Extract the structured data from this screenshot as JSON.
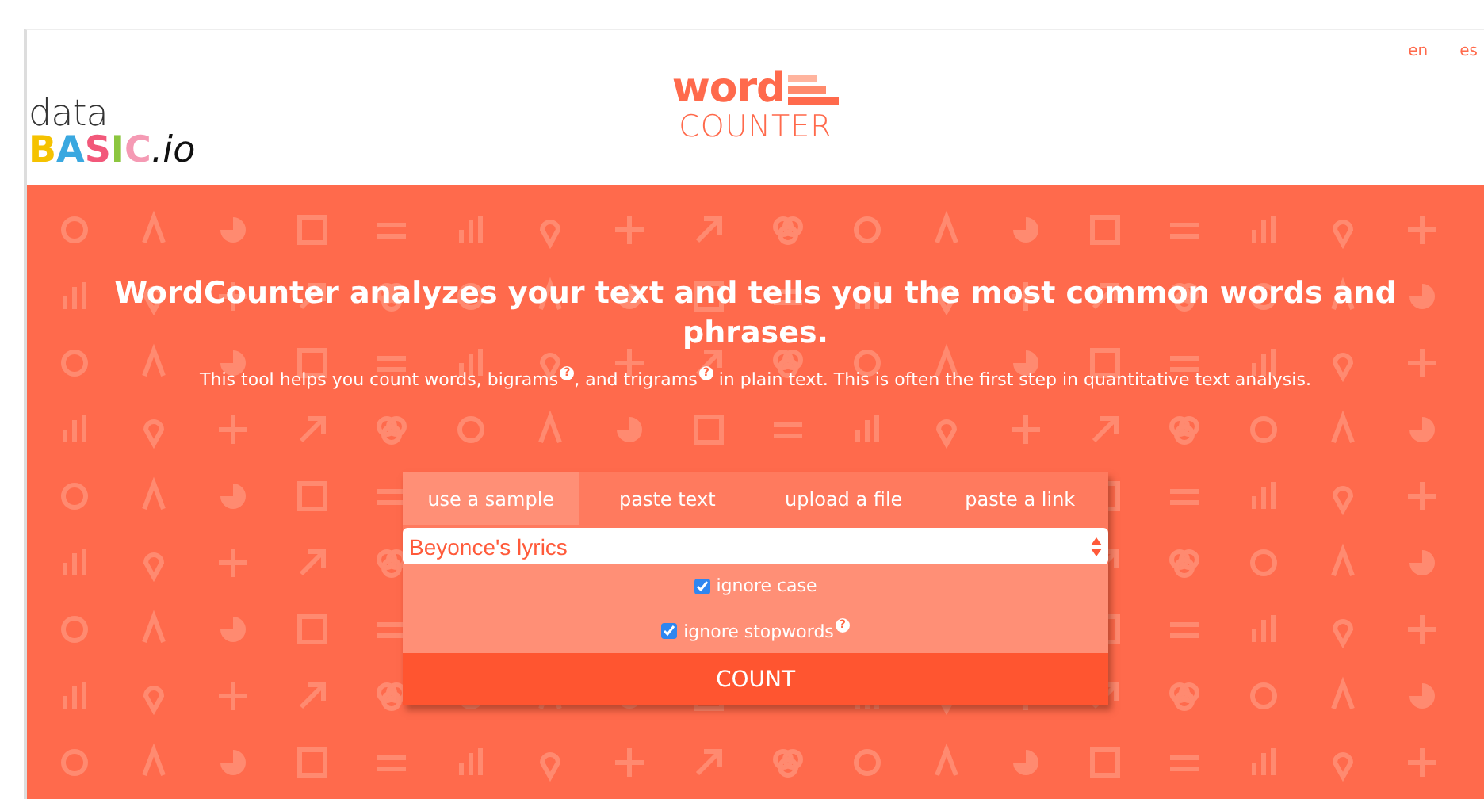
{
  "header": {
    "logo": {
      "top": "data",
      "letters": [
        {
          "text": "B",
          "color": "#f5c200"
        },
        {
          "text": "A",
          "color": "#3aa8e0"
        },
        {
          "text": "S",
          "color": "#f2587a"
        },
        {
          "text": "I",
          "color": "#8cc63f"
        },
        {
          "text": "C",
          "color": "#f59ab4"
        }
      ],
      "suffix": ".io"
    },
    "app_logo": {
      "word": "word",
      "subtitle": "COUNTER"
    },
    "languages": [
      {
        "label": "en"
      },
      {
        "label": "es"
      }
    ]
  },
  "hero": {
    "headline": "WordCounter analyzes your text and tells you the most common words and phrases.",
    "description": "This tool helps you count words, bigrams$^{?}$, and trigrams$^{?}$ in plain text. This is often the first step in quantitative text analysis."
  },
  "tabs": [
    {
      "label": "use a sample",
      "selected": true
    },
    {
      "label": "paste text",
      "selected": false
    },
    {
      "label": "upload a file",
      "selected": false
    },
    {
      "label": "paste a link",
      "selected": false
    }
  ],
  "sample_select": {
    "value": "Beyonce's lyrics"
  },
  "options": [
    {
      "label": "ignore case",
      "checked": true
    },
    {
      "label": "ignore stopwords$^{?}$",
      "checked": true
    }
  ],
  "count_button": "COUNT"
}
